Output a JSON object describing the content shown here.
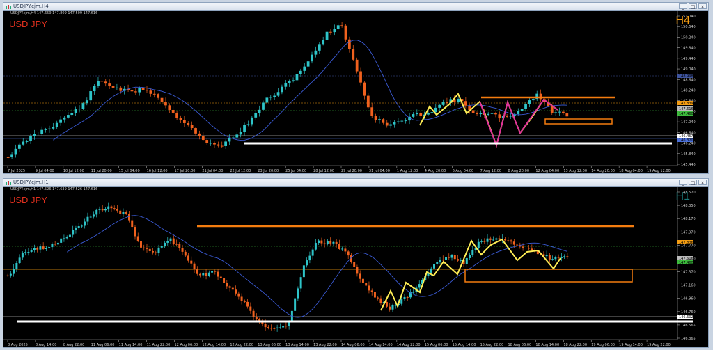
{
  "windows": [
    {
      "title": "USDJPY.cjm,H4",
      "symbol": "USD JPY",
      "timeframe": "H4",
      "timeframe_color": "#f39c12",
      "ohlc": "USDJPY.cjm,H4 147.659 147.809 147.509 147.616",
      "price_labels": [
        "151.040",
        "150.640",
        "150.240",
        "149.840",
        "149.440",
        "149.040",
        "148.640",
        "148.240",
        "147.840",
        "147.440",
        "147.040",
        "146.640",
        "146.240",
        "145.840",
        "145.440"
      ],
      "tags": {
        "top": "148.998",
        "orange": "147.839",
        "current": "147.616",
        "green": "147.460",
        "mid": "146.467",
        "blue": "146.320"
      },
      "time_labels": [
        "7 Jul 2025",
        "9 Jul 04:00",
        "10 Jul 12:00",
        "11 Jul 20:00",
        "15 Jul 04:00",
        "16 Jul 12:00",
        "17 Jul 20:00",
        "21 Jul 04:00",
        "22 Jul 12:00",
        "23 Jul 20:00",
        "25 Jul 04:00",
        "28 Jul 12:00",
        "29 Jul 20:00",
        "31 Jul 04:00",
        "1 Aug 12:00",
        "4 Aug 20:00",
        "6 Aug 04:00",
        "7 Aug 12:00",
        "8 Aug 20:00",
        "12 Aug 04:00",
        "13 Aug 12:00",
        "14 Aug 20:00",
        "18 Aug 04:00",
        "19 Aug 12:00"
      ]
    },
    {
      "title": "USDJPY.cjm,H1",
      "symbol": "USD JPY",
      "timeframe": "H1",
      "timeframe_color": "#1a7a7a",
      "ohlc": "USDJPY.cjm,H1 147.526 147.639 147.526 147.616",
      "price_labels": [
        "148.570",
        "148.350",
        "148.170",
        "147.970",
        "147.770",
        "147.570",
        "147.370",
        "147.160",
        "146.960",
        "146.760",
        "146.565",
        "146.365"
      ],
      "tags": {
        "orange": "147.836",
        "current": "147.616",
        "green": "147.460",
        "mid": "146.602"
      },
      "time_labels": [
        "8 Aug 2025",
        "8 Aug 14:00",
        "8 Aug 22:00",
        "11 Aug 06:00",
        "11 Aug 14:00",
        "11 Aug 22:00",
        "12 Aug 06:00",
        "12 Aug 14:00",
        "12 Aug 22:00",
        "13 Aug 06:00",
        "13 Aug 14:00",
        "13 Aug 22:00",
        "14 Aug 06:00",
        "14 Aug 14:00",
        "14 Aug 22:00",
        "15 Aug 06:00",
        "15 Aug 14:00",
        "15 Aug 22:00",
        "18 Aug 06:00",
        "18 Aug 14:00",
        "18 Aug 22:00",
        "19 Aug 06:00",
        "19 Aug 14:00",
        "19 Aug 22:00"
      ]
    }
  ],
  "colors": {
    "bull": "#2ec4c8",
    "bear": "#f0611e",
    "ma": "#3b5bd6",
    "zigzag": "#ffee55",
    "zigzag2": "#e0309a",
    "resistance": "#f47c0f",
    "support": "#ffffff"
  }
}
